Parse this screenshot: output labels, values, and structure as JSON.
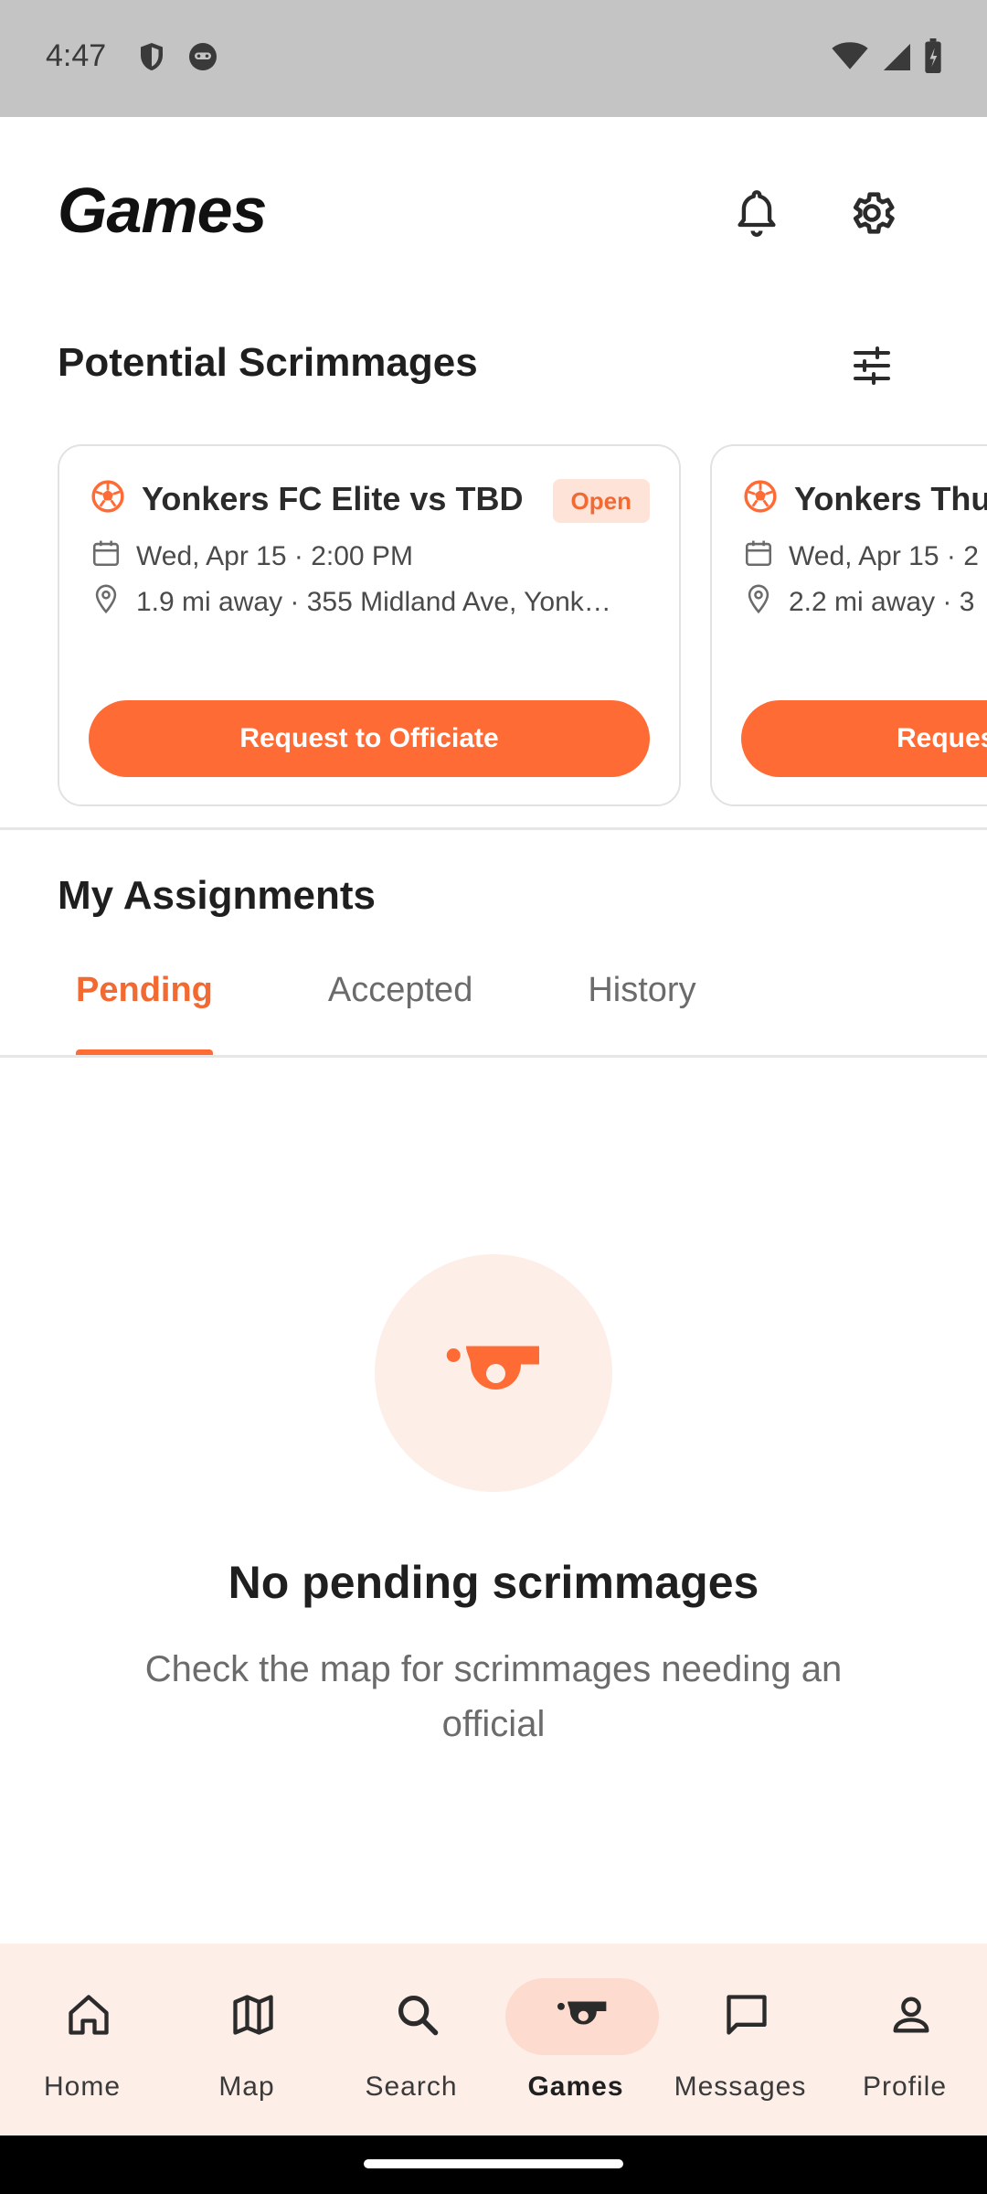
{
  "status_bar": {
    "time": "4:47",
    "icons": [
      "shield-icon",
      "face-icon",
      "wifi-icon",
      "cellular-icon",
      "battery-icon"
    ]
  },
  "header": {
    "title": "Games",
    "icons": [
      "bell-icon",
      "gear-icon"
    ]
  },
  "scrimmages": {
    "title": "Potential Scrimmages",
    "cards": [
      {
        "title": "Yonkers FC Elite vs TBD",
        "badge": "Open",
        "datetime": "Wed, Apr 15 · 2:00 PM",
        "location": "1.9 mi away · 355 Midland Ave, Yonk…",
        "button": "Request to Officiate"
      },
      {
        "title": "Yonkers Thu",
        "datetime": "Wed, Apr 15 · 2",
        "location": "2.2 mi away · 3",
        "button": "Reques"
      }
    ]
  },
  "assignments": {
    "title": "My Assignments",
    "tabs": [
      {
        "label": "Pending",
        "active": true
      },
      {
        "label": "Accepted",
        "active": false
      },
      {
        "label": "History",
        "active": false
      }
    ],
    "empty_title": "No pending scrimmages",
    "empty_subtitle": "Check the map for scrimmages needing an official"
  },
  "bottom_nav": {
    "items": [
      {
        "label": "Home",
        "icon": "home-icon"
      },
      {
        "label": "Map",
        "icon": "map-icon"
      },
      {
        "label": "Search",
        "icon": "search-icon"
      },
      {
        "label": "Games",
        "icon": "whistle-icon",
        "active": true
      },
      {
        "label": "Messages",
        "icon": "message-icon"
      },
      {
        "label": "Profile",
        "icon": "profile-icon"
      }
    ]
  },
  "colors": {
    "accent": "#ff6b35",
    "badge_bg": "#fde3d8",
    "nav_bg": "#fdeee8"
  }
}
